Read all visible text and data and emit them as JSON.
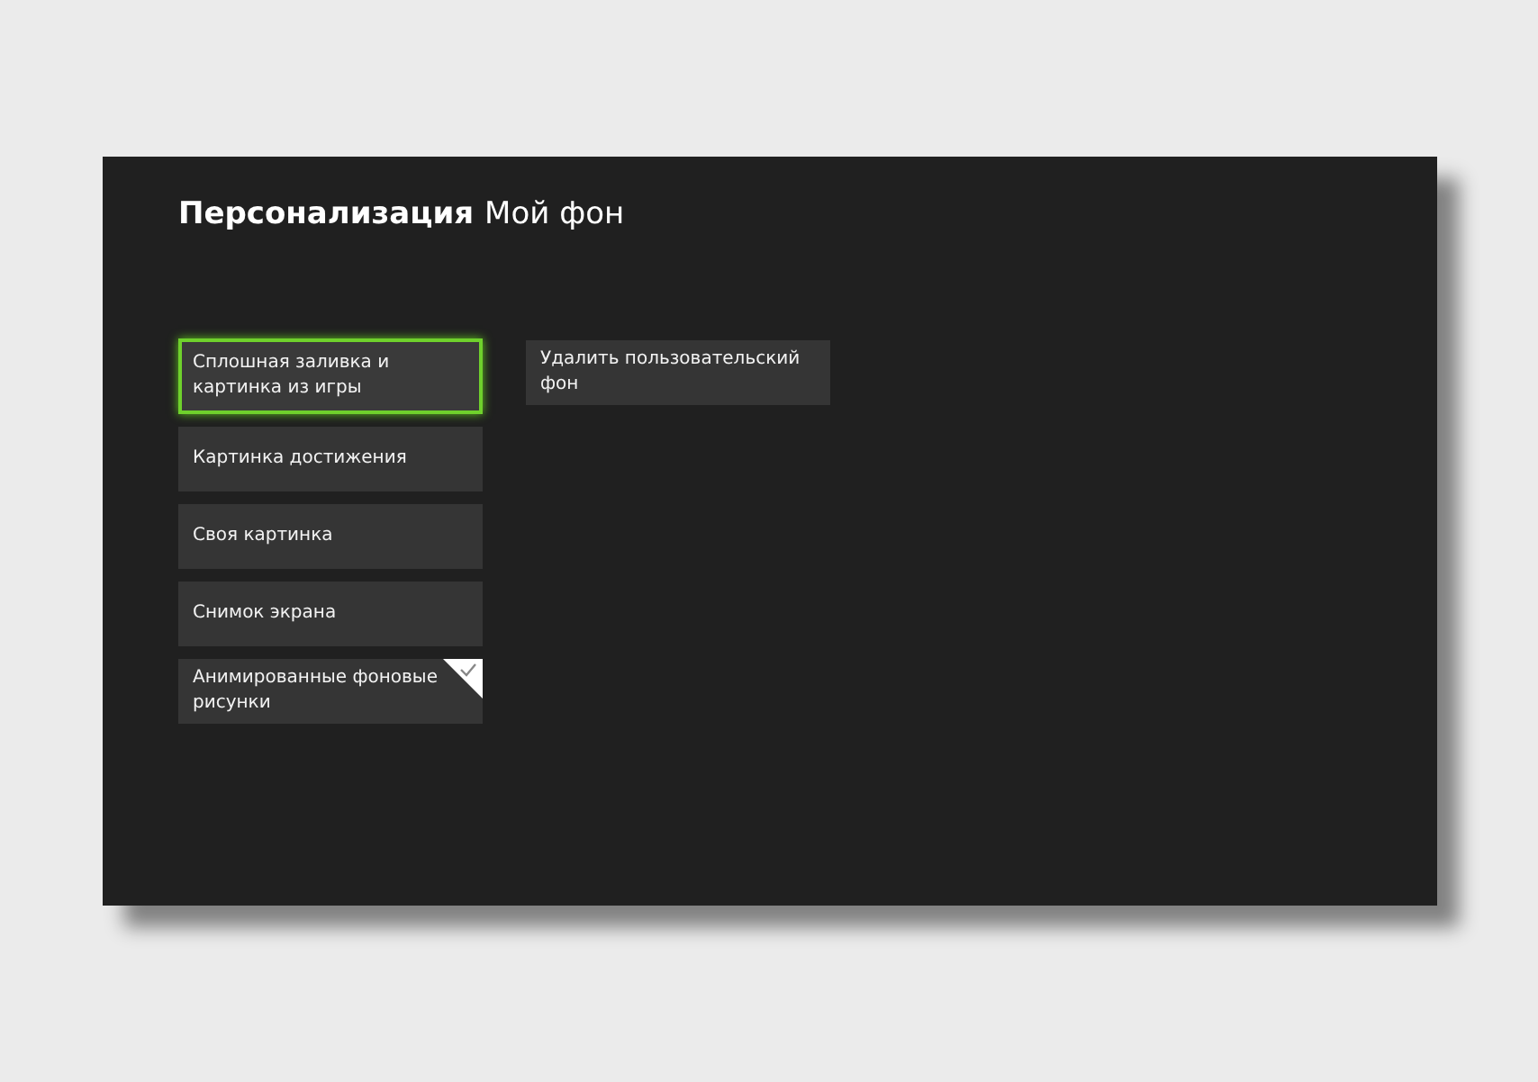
{
  "header": {
    "section": "Персонализация",
    "page": "Мой фон"
  },
  "options": [
    {
      "label": "Сплошная заливка и картинка из игры",
      "selected": true,
      "checked": false
    },
    {
      "label": "Картинка достижения",
      "selected": false,
      "checked": false
    },
    {
      "label": "Своя картинка",
      "selected": false,
      "checked": false
    },
    {
      "label": "Снимок экрана",
      "selected": false,
      "checked": false
    },
    {
      "label": "Анимированные фоновые рисунки",
      "selected": false,
      "checked": true
    }
  ],
  "actions": [
    {
      "label": "Удалить пользовательский фон"
    }
  ]
}
